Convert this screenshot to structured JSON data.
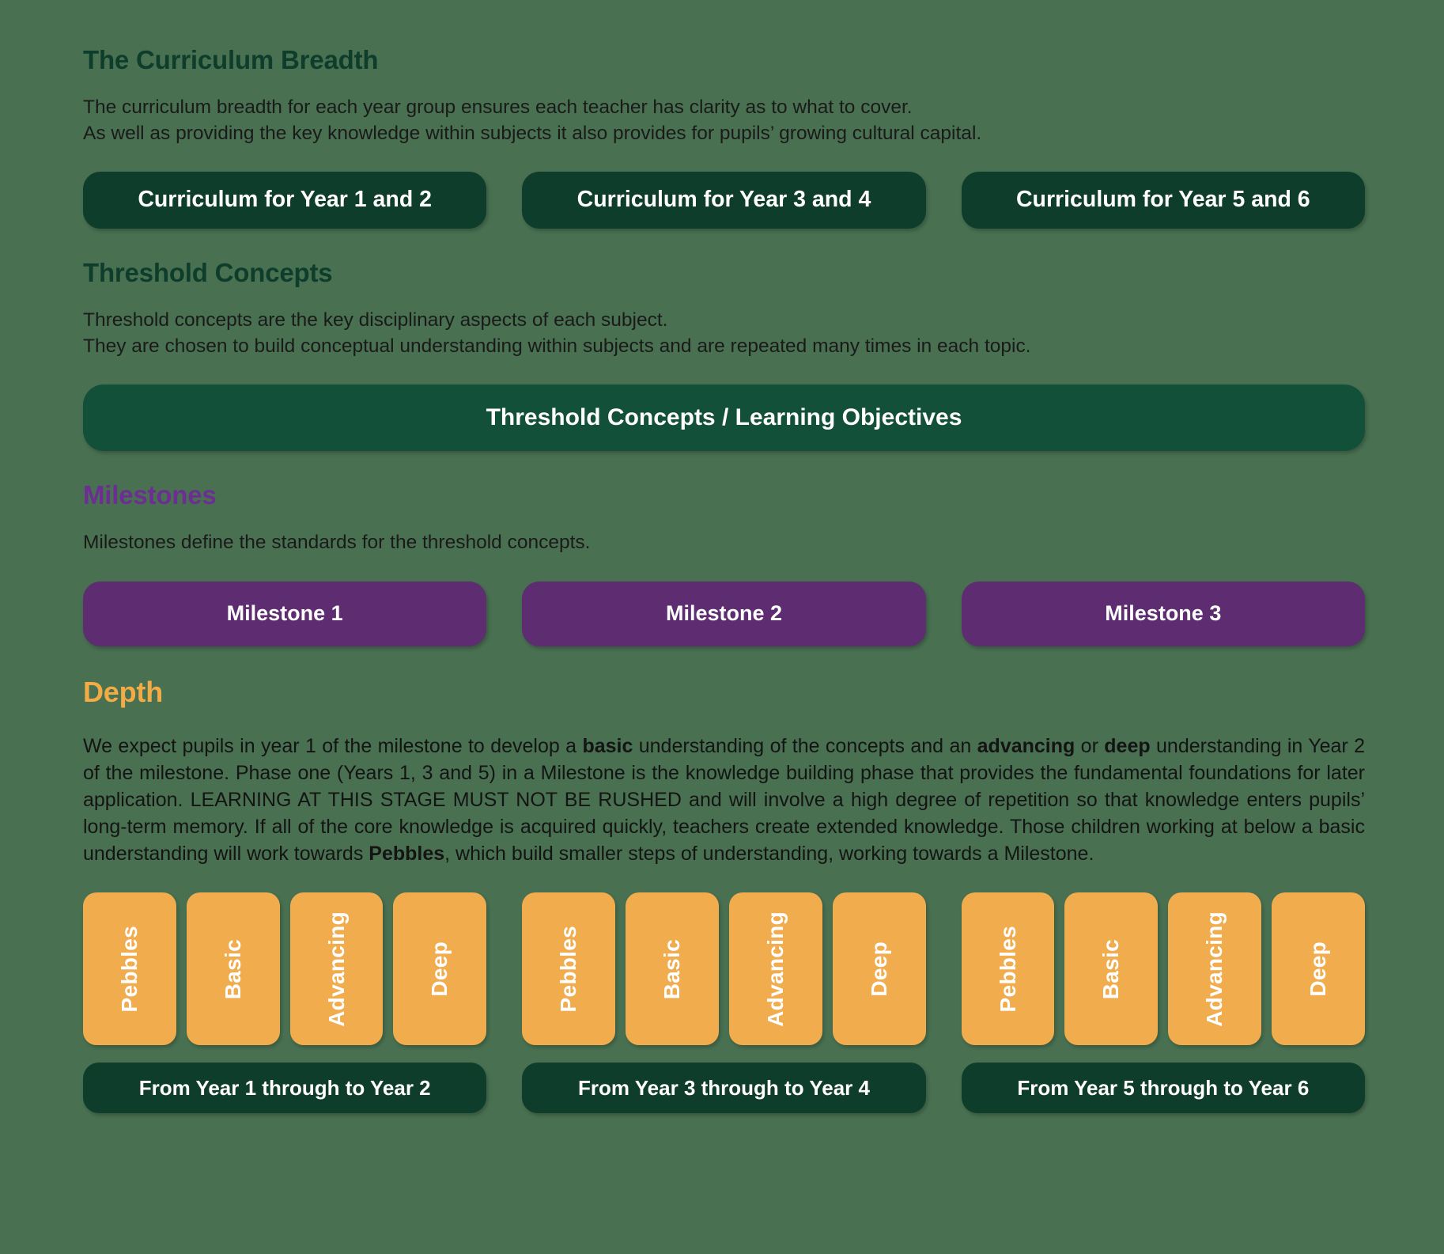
{
  "sections": {
    "breadth": {
      "heading": "The Curriculum Breadth",
      "body_line1": "The curriculum breadth for each year group ensures each teacher has clarity as to what to cover.",
      "body_line2": "As well as providing the key knowledge within subjects it also provides for pupils’ growing cultural capital.",
      "buttons": [
        "Curriculum for Year 1 and 2",
        "Curriculum for Year 3 and 4",
        "Curriculum for Year 5 and 6"
      ]
    },
    "threshold": {
      "heading": "Threshold Concepts",
      "body_line1": "Threshold concepts are the key disciplinary aspects of each subject.",
      "body_line2": "They are chosen to build conceptual understanding within subjects and are repeated many times in each topic.",
      "bar_label": "Threshold Concepts / Learning Objectives"
    },
    "milestones": {
      "heading": "Milestones",
      "body_line1": "Milestones define the standards for the threshold concepts.",
      "buttons": [
        "Milestone 1",
        "Milestone 2",
        "Milestone 3"
      ]
    },
    "depth": {
      "heading": "Depth",
      "paragraph_html": "We expect pupils in year 1 of the milestone to develop a <b>basic</b> understanding of the concepts and an <b>advancing</b> or <b>deep</b> understanding in Year 2 of the milestone.  Phase one (Years 1, 3 and 5) in a Milestone is the knowledge building phase that provides the fundamental foundations for later application. LEARNING AT THIS STAGE MUST NOT BE RUSHED and will involve a high degree of repetition so that knowledge enters pupils’ long-term memory. If all of the core knowledge is acquired quickly, teachers create extended knowledge.  Those children working at below a basic understanding will work towards <b>Pebbles</b>, which build smaller steps of understanding, working towards a Milestone.",
      "groups": [
        {
          "levels": [
            "Pebbles",
            "Basic",
            "Advancing",
            "Deep"
          ],
          "year_range": "From Year 1 through to Year 2"
        },
        {
          "levels": [
            "Pebbles",
            "Basic",
            "Advancing",
            "Deep"
          ],
          "year_range": "From Year 3 through to Year 4"
        },
        {
          "levels": [
            "Pebbles",
            "Basic",
            "Advancing",
            "Deep"
          ],
          "year_range": "From Year 5 through to Year 6"
        }
      ]
    }
  },
  "colors": {
    "background": "#487051",
    "dark_green": "#0f3d2c",
    "bar_green": "#13503a",
    "purple": "#5e2c70",
    "heading_purple": "#6d2e93",
    "orange": "#f0ac4d",
    "heading_orange": "#f2ab45",
    "text": "#141414",
    "white": "#ffffff"
  }
}
